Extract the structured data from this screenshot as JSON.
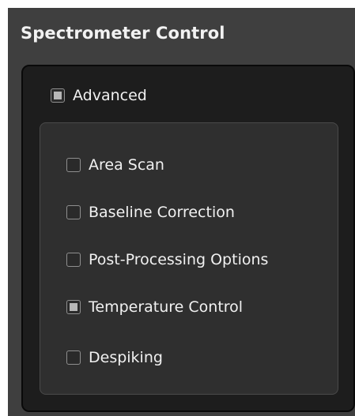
{
  "panel": {
    "title": "Spectrometer Control"
  },
  "advanced": {
    "label": "Advanced",
    "checked": true
  },
  "options": [
    {
      "label": "Area Scan",
      "checked": false
    },
    {
      "label": "Baseline Correction",
      "checked": false
    },
    {
      "label": "Post-Processing Options",
      "checked": false
    },
    {
      "label": "Temperature Control",
      "checked": true
    },
    {
      "label": "Despiking",
      "checked": false
    }
  ]
}
